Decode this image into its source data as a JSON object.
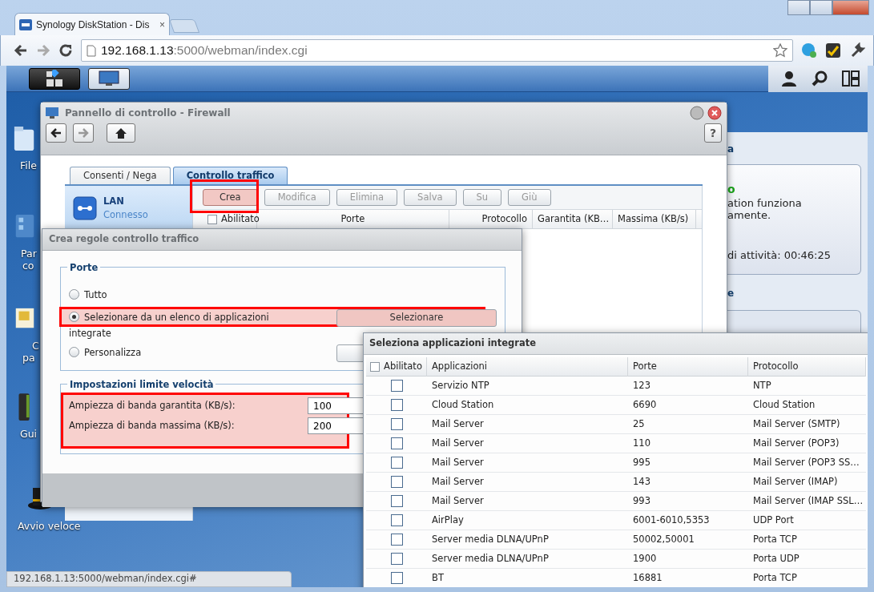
{
  "browser": {
    "tab_title": "Synology DiskStation - Dis",
    "tab_close": "×",
    "address_host": "192.168.1.13",
    "address_path": ":5000/webman/index.cgi",
    "status_url": "192.168.1.13:5000/webman/index.cgi#"
  },
  "desktop_icons": [
    {
      "label_lines": [
        "File"
      ]
    },
    {
      "label_lines": [
        "Par",
        "co"
      ]
    },
    {
      "label_lines": [
        "C",
        "pa"
      ]
    },
    {
      "label_lines": [
        "Gui"
      ]
    },
    {
      "label_lines": [
        "Avvio veloce"
      ]
    }
  ],
  "background_widget": {
    "title": "a",
    "status": "o",
    "message_lines": [
      "ation funziona",
      "amente."
    ],
    "uptime": "di attività: 00:46:25",
    "section_title": "e"
  },
  "control_panel": {
    "title": "Pannello di controllo - Firewall",
    "help": "?",
    "tabs": [
      {
        "label": "Consenti / Nega",
        "selected": false
      },
      {
        "label": "Controllo traffico",
        "selected": true
      }
    ],
    "interface": {
      "name": "LAN",
      "status": "Connesso"
    },
    "toolbar": [
      {
        "label": "Crea",
        "highlighted": true,
        "disabled": false
      },
      {
        "label": "Modifica",
        "highlighted": false,
        "disabled": true
      },
      {
        "label": "Elimina",
        "highlighted": false,
        "disabled": true
      },
      {
        "label": "Salva",
        "highlighted": false,
        "disabled": true
      },
      {
        "label": "Su",
        "highlighted": false,
        "disabled": true
      },
      {
        "label": "Giù",
        "highlighted": false,
        "disabled": true
      }
    ],
    "columns": [
      "Abilitato",
      "Porte",
      "Protocollo",
      "Garantita (KB…",
      "Massima (KB/s)"
    ],
    "header_checked": false
  },
  "dialog": {
    "title": "Crea regole controllo traffico",
    "ports_legend": "Porte",
    "options": [
      {
        "kind": "all",
        "label": "Tutto",
        "selected": false,
        "highlighted": false
      },
      {
        "kind": "list",
        "label": "Selezionare da un elenco di applicazioni integrate",
        "selected": true,
        "highlighted": true,
        "button": "Selezionare"
      },
      {
        "kind": "custom",
        "label": "Personalizza",
        "selected": false,
        "highlighted": false
      }
    ],
    "speed_legend": "Impostazioni limite velocità",
    "speed_highlighted": true,
    "speed_fields": [
      {
        "label": "Ampiezza di banda garantita (KB/s):",
        "value": "100"
      },
      {
        "label": "Ampiezza di banda massima (KB/s):",
        "value": "200"
      }
    ]
  },
  "app_picker": {
    "title": "Seleziona applicazioni integrate",
    "columns": [
      "Abilitato",
      "Applicazioni",
      "Porte",
      "Protocollo"
    ],
    "header_checked": false,
    "rows": [
      {
        "checked": false,
        "application": "Servizio NTP",
        "ports": "123",
        "protocol": "NTP"
      },
      {
        "checked": false,
        "application": "Cloud Station",
        "ports": "6690",
        "protocol": "Cloud Station"
      },
      {
        "checked": false,
        "application": "Mail Server",
        "ports": "25",
        "protocol": "Mail Server (SMTP)"
      },
      {
        "checked": false,
        "application": "Mail Server",
        "ports": "110",
        "protocol": "Mail Server (POP3)"
      },
      {
        "checked": false,
        "application": "Mail Server",
        "ports": "995",
        "protocol": "Mail Server (POP3 SS…"
      },
      {
        "checked": false,
        "application": "Mail Server",
        "ports": "143",
        "protocol": "Mail Server (IMAP)"
      },
      {
        "checked": false,
        "application": "Mail Server",
        "ports": "993",
        "protocol": "Mail Server (IMAP SSL…"
      },
      {
        "checked": false,
        "application": "AirPlay",
        "ports": "6001-6010,5353",
        "protocol": "UDP Port"
      },
      {
        "checked": false,
        "application": "Server media DLNA/UPnP",
        "ports": "50002,50001",
        "protocol": "Porta TCP"
      },
      {
        "checked": false,
        "application": "Server media DLNA/UPnP",
        "ports": "1900",
        "protocol": "Porta UDP"
      },
      {
        "checked": false,
        "application": "BT",
        "ports": "16881",
        "protocol": "Porta TCP"
      }
    ]
  }
}
